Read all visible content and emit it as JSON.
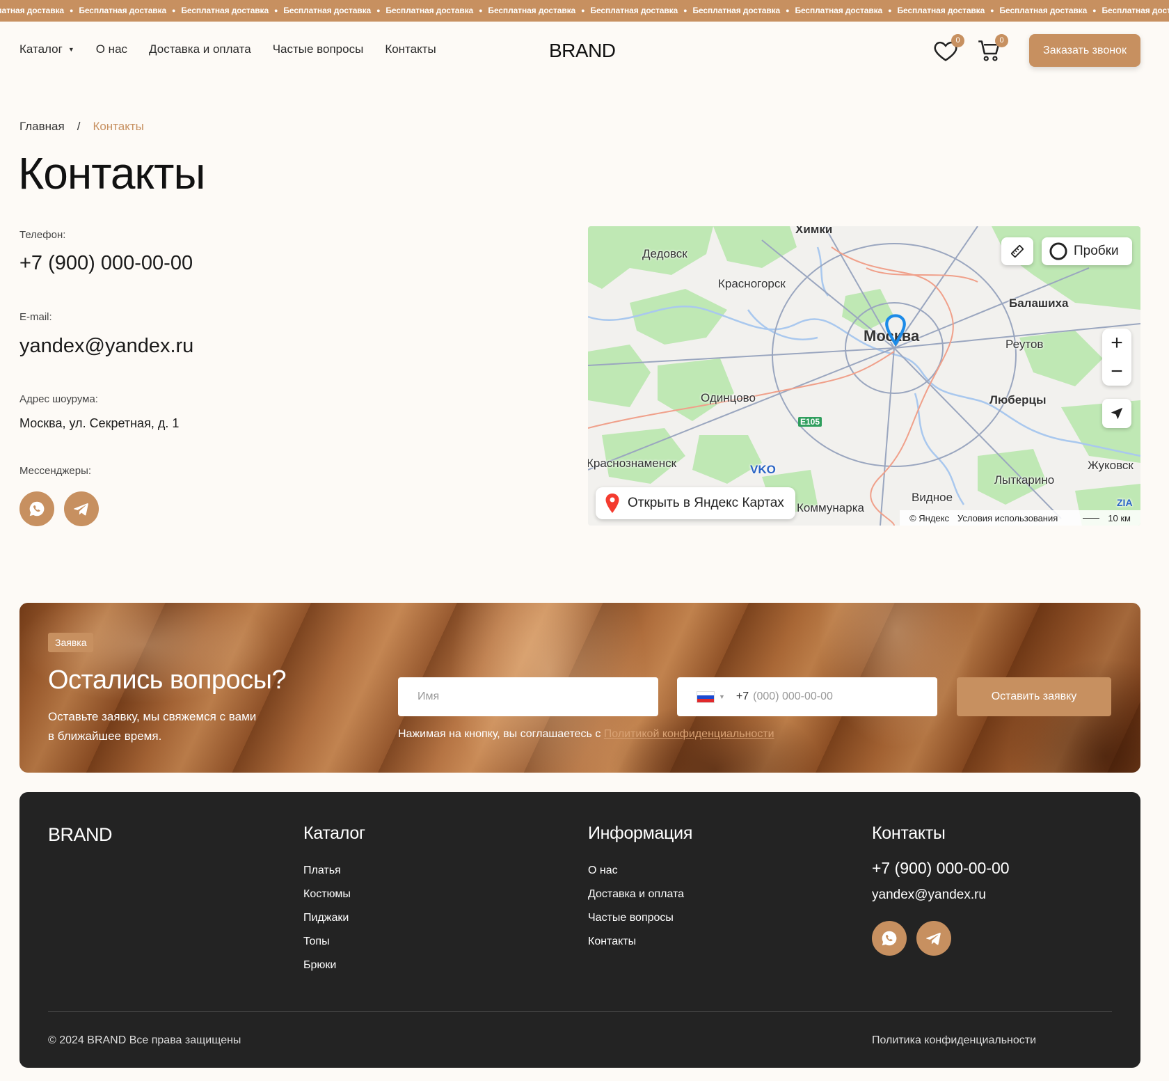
{
  "ticker": {
    "text": "Бесплатная доставка",
    "lead_fragment": "латная доставка"
  },
  "header": {
    "nav": [
      {
        "label": "Каталог"
      },
      {
        "label": "О нас"
      },
      {
        "label": "Доставка и оплата"
      },
      {
        "label": "Частые вопросы"
      },
      {
        "label": "Контакты"
      }
    ],
    "logo": "BRAND",
    "favorites_count": "0",
    "cart_count": "0",
    "call_button": "Заказать звонок"
  },
  "breadcrumb": {
    "home": "Главная",
    "separator": "/",
    "current": "Контакты"
  },
  "page_title": "Контакты",
  "contacts": {
    "phone_label": "Телефон:",
    "phone": "+7 (900) 000-00-00",
    "email_label": "E-mail:",
    "email": "yandex@yandex.ru",
    "address_label": "Адрес шоурума:",
    "address": "Москва, ул. Секретная, д. 1",
    "messengers_label": "Мессенджеры:"
  },
  "map": {
    "traffic_button": "Пробки",
    "open_button": "Открыть в Яндекс Картах",
    "copyright": "© Яндекс",
    "terms": "Условия использования",
    "scale": "10 км",
    "zoom_in": "+",
    "zoom_out": "−",
    "places": {
      "khimki": "Химки",
      "dedovsk": "Дедовск",
      "krasnogorsk": "Красногорск",
      "balashikha": "Балашиха",
      "moscow": "Москва",
      "reutov": "Реутов",
      "odintsovo": "Одинцово",
      "lyubertsy": "Люберцы",
      "e105": "E105",
      "krasnoznamensk": "Краснознаменск",
      "vko": "VKO",
      "zhukovsk": "Жуковск",
      "lytkarino": "Лыткарино",
      "vidnoe": "Видное",
      "kommunarka": "Коммунарка",
      "zia": "ZIA"
    }
  },
  "request": {
    "tag": "Заявка",
    "title": "Остались вопросы?",
    "subtitle": "Оставьте заявку, мы свяжемся с вами в ближайшее время.",
    "name_placeholder": "Имя",
    "phone_prefix": "+7",
    "phone_placeholder": "(000) 000-00-00",
    "submit": "Оставить заявку",
    "consent_text": "Нажимая на кнопку, вы соглашаетесь с",
    "consent_link": "Политикой конфиденциальности"
  },
  "footer": {
    "logo": "BRAND",
    "catalog_title": "Каталог",
    "catalog_links": [
      {
        "label": "Платья"
      },
      {
        "label": "Костюмы"
      },
      {
        "label": "Пиджаки"
      },
      {
        "label": "Топы"
      },
      {
        "label": "Брюки"
      }
    ],
    "info_title": "Информация",
    "info_links": [
      {
        "label": "О нас"
      },
      {
        "label": "Доставка и оплата"
      },
      {
        "label": "Частые вопросы"
      },
      {
        "label": "Контакты"
      }
    ],
    "contacts_title": "Контакты",
    "phone": "+7 (900) 000-00-00",
    "email": "yandex@yandex.ru",
    "copyright": "© 2024 BRAND Все права защищены",
    "policy": "Политика конфиденциальности"
  },
  "colors": {
    "accent": "#c79060",
    "footer_bg": "#232323",
    "page_bg": "#fdfaf6"
  }
}
